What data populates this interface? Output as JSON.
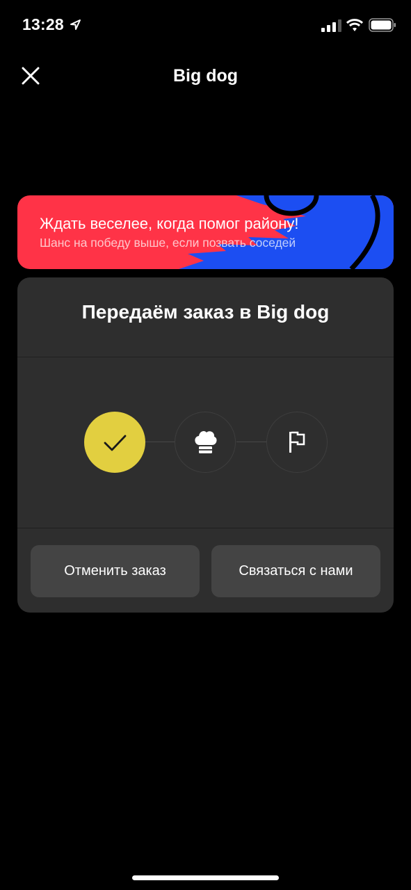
{
  "status_bar": {
    "time": "13:28"
  },
  "header": {
    "title": "Big dog"
  },
  "promo": {
    "title": "Ждать веселее, когда помог району!",
    "subtitle": "Шанс на победу выше, если позвать соседей"
  },
  "order_status": {
    "title": "Передаём заказ в Big dog",
    "steps": [
      {
        "icon": "checkmark-icon",
        "state": "done"
      },
      {
        "icon": "chef-hat-icon",
        "state": "pending"
      },
      {
        "icon": "flag-icon",
        "state": "pending"
      }
    ],
    "cancel_label": "Отменить заказ",
    "contact_label": "Связаться с нами"
  },
  "colors": {
    "background": "#000000",
    "card": "#2e2e2e",
    "button": "#444444",
    "accent_yellow": "#e2cf40",
    "promo_red": "#ff3347",
    "promo_blue": "#1c4ef2"
  }
}
